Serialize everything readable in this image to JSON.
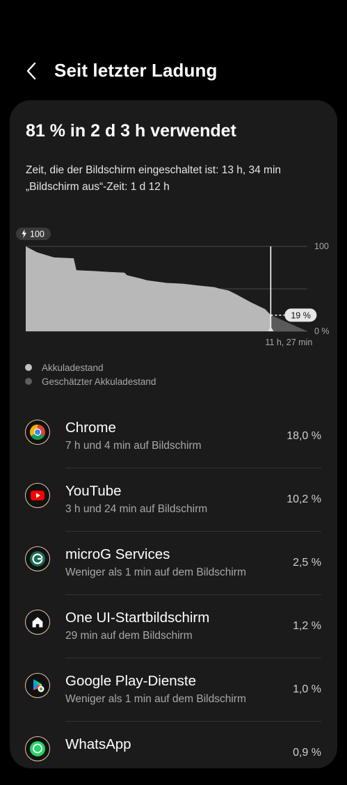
{
  "header": {
    "title": "Seit letzter Ladung"
  },
  "summary": {
    "title": "81 % in 2 d 3 h verwendet",
    "screen_on": "Zeit, die der Bildschirm eingeschaltet ist: 13 h, 34 min",
    "screen_off": "„Bildschirm aus“-Zeit: 1 d 12 h"
  },
  "chart": {
    "charge_badge": "100",
    "y_top_label": "100",
    "y_bottom_label": "0 %",
    "current_label": "19 %",
    "remaining_label": "11 h, 27 min"
  },
  "chart_data": {
    "type": "area",
    "ylim": [
      0,
      100
    ],
    "grid": true,
    "series": [
      {
        "name": "Akkuladestand",
        "x": [
          0,
          0.04,
          0.09,
          0.1,
          0.17,
          0.18,
          0.24,
          0.29,
          0.35,
          0.36,
          0.41,
          0.43,
          0.5,
          0.56,
          0.61,
          0.67,
          0.69,
          0.72,
          0.75,
          0.8,
          0.85,
          0.87
        ],
        "values": [
          100,
          93,
          88,
          87,
          86,
          72,
          71,
          70,
          69,
          66,
          62,
          60,
          57,
          56,
          54,
          52,
          50,
          48,
          43,
          34,
          26,
          19
        ],
        "color": "#b8b8b8"
      },
      {
        "name": "Geschätzter Akkuladestand",
        "x": [
          0.87,
          1.0
        ],
        "values": [
          19,
          0
        ],
        "color": "#5a5a5a"
      }
    ]
  },
  "legend": {
    "items": [
      {
        "label": "Akkuladestand",
        "color": "#c2c2c2"
      },
      {
        "label": "Geschätzter Akkuladestand",
        "color": "#5e5e5e"
      }
    ]
  },
  "apps": [
    {
      "name": "Chrome",
      "usage": "7 h und 4 min auf Bildschirm",
      "percent": "18,0 %",
      "icon": "chrome-icon"
    },
    {
      "name": "YouTube",
      "usage": "3 h und 24 min auf Bildschirm",
      "percent": "10,2 %",
      "icon": "youtube-icon"
    },
    {
      "name": "microG Services",
      "usage": "Weniger als 1 min auf dem Bildschirm",
      "percent": "2,5 %",
      "icon": "microg-icon"
    },
    {
      "name": "One UI-Startbildschirm",
      "usage": "29 min auf dem Bildschirm",
      "percent": "1,2 %",
      "icon": "home-icon"
    },
    {
      "name": "Google Play-Dienste",
      "usage": "Weniger als 1 min auf dem Bildschirm",
      "percent": "1,0 %",
      "icon": "play-services-icon"
    },
    {
      "name": "WhatsApp",
      "usage": "",
      "percent": "0,9 %",
      "icon": "whatsapp-icon"
    }
  ]
}
